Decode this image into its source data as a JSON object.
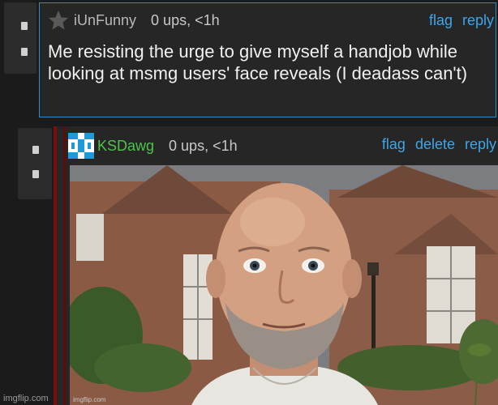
{
  "comment1": {
    "username": "iUnFunny",
    "meta": "0 ups, <1h",
    "actions": [
      "flag",
      "reply"
    ],
    "text": "Me resisting the urge to give myself a handjob while looking at msmg users' face reveals (I deadass can't)"
  },
  "comment2": {
    "username": "KSDawg",
    "meta": "0 ups, <1h",
    "actions": [
      "flag",
      "delete",
      "reply"
    ],
    "image_watermark": "imgflip.com"
  },
  "watermark": "imgflip.com",
  "colors": {
    "link": "#3aa7ec",
    "username2": "#4fc24a",
    "border1": "#2a8fc4",
    "thread_bar": "#7b0d0d"
  },
  "icons": {
    "avatar1": "star-icon",
    "avatar2": "pixel-logo-icon"
  }
}
